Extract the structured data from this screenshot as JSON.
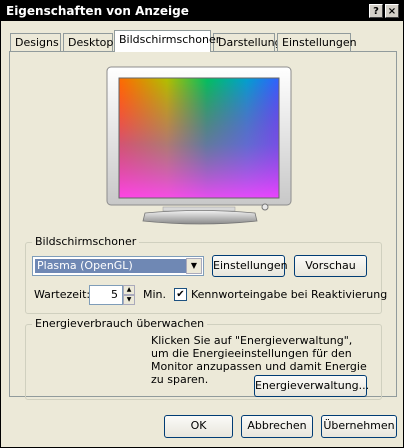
{
  "window": {
    "title": "Eigenschaften von Anzeige",
    "help_glyph": "?",
    "close_glyph": "×"
  },
  "tabs": [
    {
      "label": "Designs"
    },
    {
      "label": "Desktop"
    },
    {
      "label": "Bildschirmschoner",
      "active": true
    },
    {
      "label": "Darstellung"
    },
    {
      "label": "Einstellungen"
    }
  ],
  "screensaver": {
    "group_label": "Bildschirmschoner",
    "selected": "Plasma (OpenGL)",
    "settings_button": "Einstellungen",
    "preview_button": "Vorschau",
    "wait_label": "Wartezeit:",
    "wait_value": "5",
    "wait_unit": "Min.",
    "password_label": "Kennworteingabe bei Reaktivierung",
    "password_checked": true,
    "check_glyph": "✔"
  },
  "power": {
    "group_label": "Energieverbrauch überwachen",
    "description": "Klicken Sie auf \"Energieverwaltung\", um die Energieeinstellungen für den Monitor anzupassen und damit Energie zu sparen.",
    "button": "Energieverwaltung..."
  },
  "footer": {
    "ok": "OK",
    "cancel": "Abbrechen",
    "apply": "Übernehmen"
  },
  "icons": {
    "monitor": "monitor-preview-icon",
    "dropdown": "chevron-down-icon"
  }
}
